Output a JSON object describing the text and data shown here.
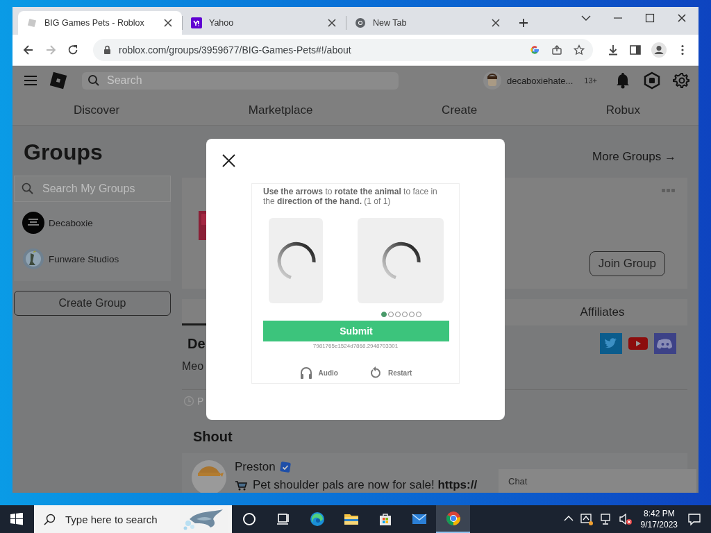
{
  "browser": {
    "tabs": [
      {
        "title": "BIG Games Pets - Roblox",
        "kind": "roblox",
        "selected": true
      },
      {
        "title": "Yahoo",
        "kind": "yahoo",
        "selected": false
      },
      {
        "title": "New Tab",
        "kind": "chrome",
        "selected": false
      }
    ],
    "forward_disabled": true,
    "url": "roblox.com/groups/3959677/BIG-Games-Pets#!/about"
  },
  "header": {
    "search_placeholder": "Search",
    "username": "decaboxiehate...",
    "age_badge": "13+",
    "nav": [
      "Discover",
      "Marketplace",
      "Create",
      "Robux"
    ]
  },
  "sidebar": {
    "title": "Groups",
    "search_placeholder": "Search My Groups",
    "groups": [
      {
        "name": "Decaboxie",
        "kind": "dark"
      },
      {
        "name": "Funware Studios",
        "kind": "light"
      }
    ],
    "create_button": "Create Group"
  },
  "group": {
    "more_link": "More Groups →",
    "join_button": "Join Group",
    "tabs": [
      {
        "label": "Affiliates",
        "selected": false
      }
    ],
    "description_heading": "De",
    "description_text": "Meo",
    "posted_text": "P",
    "social_links": [
      {
        "kind": "twitter"
      },
      {
        "kind": "youtube"
      },
      {
        "kind": "discord"
      }
    ]
  },
  "shout": {
    "title": "Shout",
    "author": "Preston",
    "verified": true,
    "text": "Pet shoulder pals are now for sale! **https://**"
  },
  "chat": {
    "label": "Chat"
  },
  "captcha": {
    "instruction": "**Use the arrows** to **rotate the animal** to face in the **direction of the hand.** (1 of 1)",
    "progress_dots": [
      {
        "selected": true
      },
      {
        "selected": false
      },
      {
        "selected": false
      },
      {
        "selected": false
      },
      {
        "selected": false
      },
      {
        "selected": false
      }
    ],
    "submit": "Submit",
    "session_id": "7981765e1524d7868.2948703301",
    "actions": [
      {
        "kind": "audio",
        "label": "Audio"
      },
      {
        "kind": "restart",
        "label": "Restart"
      }
    ]
  },
  "taskbar": {
    "search_placeholder": "Type here to search",
    "apps": [
      {
        "kind": "cortana",
        "selected": false
      },
      {
        "kind": "taskview",
        "selected": false
      },
      {
        "kind": "edge",
        "selected": false
      },
      {
        "kind": "explorer",
        "selected": false
      },
      {
        "kind": "store",
        "selected": false
      },
      {
        "kind": "mail",
        "selected": false
      },
      {
        "kind": "chrome",
        "selected": true
      }
    ],
    "time": "8:42 PM",
    "date": "9/17/2023"
  }
}
